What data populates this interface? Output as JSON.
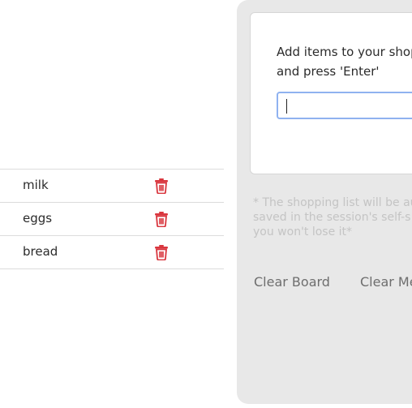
{
  "list": {
    "items": [
      {
        "name": "milk"
      },
      {
        "name": "eggs"
      },
      {
        "name": "bread"
      }
    ],
    "delete_icon": "trash-icon",
    "delete_color": "#d9363e"
  },
  "panel": {
    "instruction_line1": "Add items to your shopp",
    "instruction_line2": "and press 'Enter'",
    "input_value": "",
    "note_line1": "* The shopping list will be au",
    "note_line2": "saved in the session's self-s",
    "note_line3": "you won't lose it*",
    "clear_board_label": "Clear Board",
    "clear_memory_label": "Clear Me"
  }
}
